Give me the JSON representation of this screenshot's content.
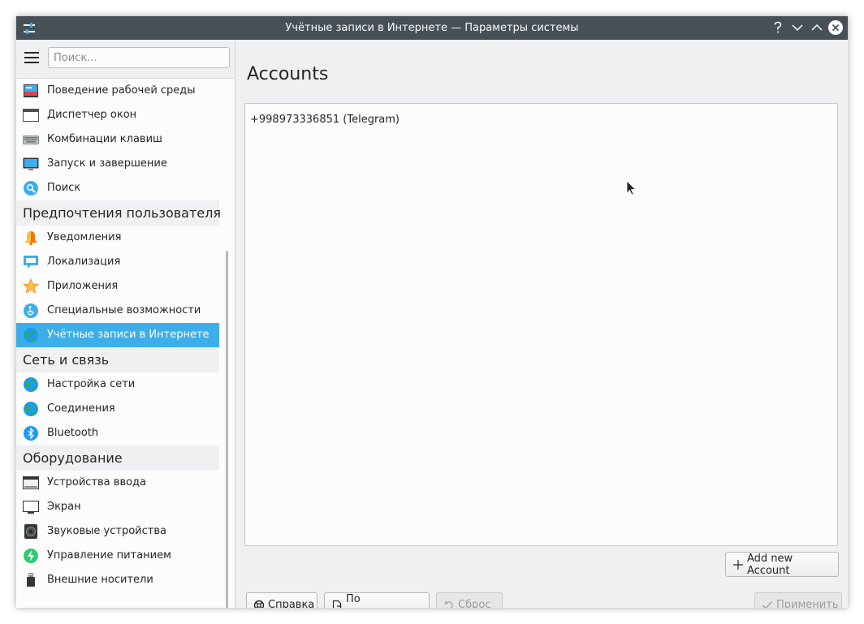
{
  "window": {
    "title": "Учётные записи в Интернете — Параметры системы",
    "buttons": [
      "help",
      "minimize",
      "maximize",
      "close"
    ]
  },
  "sidebar": {
    "search_placeholder": "Поиск...",
    "items_top": [
      {
        "label": "Поведение рабочей среды",
        "icon": "desktop-behavior-icon"
      },
      {
        "label": "Диспетчер окон",
        "icon": "window-manager-icon"
      },
      {
        "label": "Комбинации клавиш",
        "icon": "keyboard-icon"
      },
      {
        "label": "Запуск и завершение",
        "icon": "startup-monitor-icon"
      },
      {
        "label": "Поиск",
        "icon": "search-icon"
      }
    ],
    "group_user": "Предпочтения пользователя",
    "items_user": [
      {
        "label": "Уведомления",
        "icon": "bell-icon"
      },
      {
        "label": "Локализация",
        "icon": "locale-icon"
      },
      {
        "label": "Приложения",
        "icon": "star-icon"
      },
      {
        "label": "Специальные возможности",
        "icon": "accessibility-icon"
      },
      {
        "label": "Учётные записи в Интернете",
        "icon": "globe-icon",
        "selected": true
      }
    ],
    "group_network": "Сеть и связь",
    "items_network": [
      {
        "label": "Настройка сети",
        "icon": "globe-icon"
      },
      {
        "label": "Соединения",
        "icon": "globe-icon"
      },
      {
        "label": "Bluetooth",
        "icon": "bluetooth-icon"
      }
    ],
    "group_hardware": "Оборудование",
    "items_hardware": [
      {
        "label": "Устройства ввода",
        "icon": "input-devices-icon"
      },
      {
        "label": "Экран",
        "icon": "display-icon"
      },
      {
        "label": "Звуковые устройства",
        "icon": "speaker-icon"
      },
      {
        "label": "Управление питанием",
        "icon": "power-icon"
      },
      {
        "label": "Внешние носители",
        "icon": "usb-drive-icon"
      }
    ]
  },
  "main": {
    "title": "Accounts",
    "accounts": [
      "+998973336851 (Telegram)"
    ],
    "add_button": "Add new Account"
  },
  "footer": {
    "help": "Справка",
    "defaults": "По умолчанию",
    "reset": "Сброс",
    "apply": "Применить"
  },
  "colors": {
    "titlebar": "#475057",
    "selection": "#3daee9",
    "window_bg": "#eff0f1"
  }
}
